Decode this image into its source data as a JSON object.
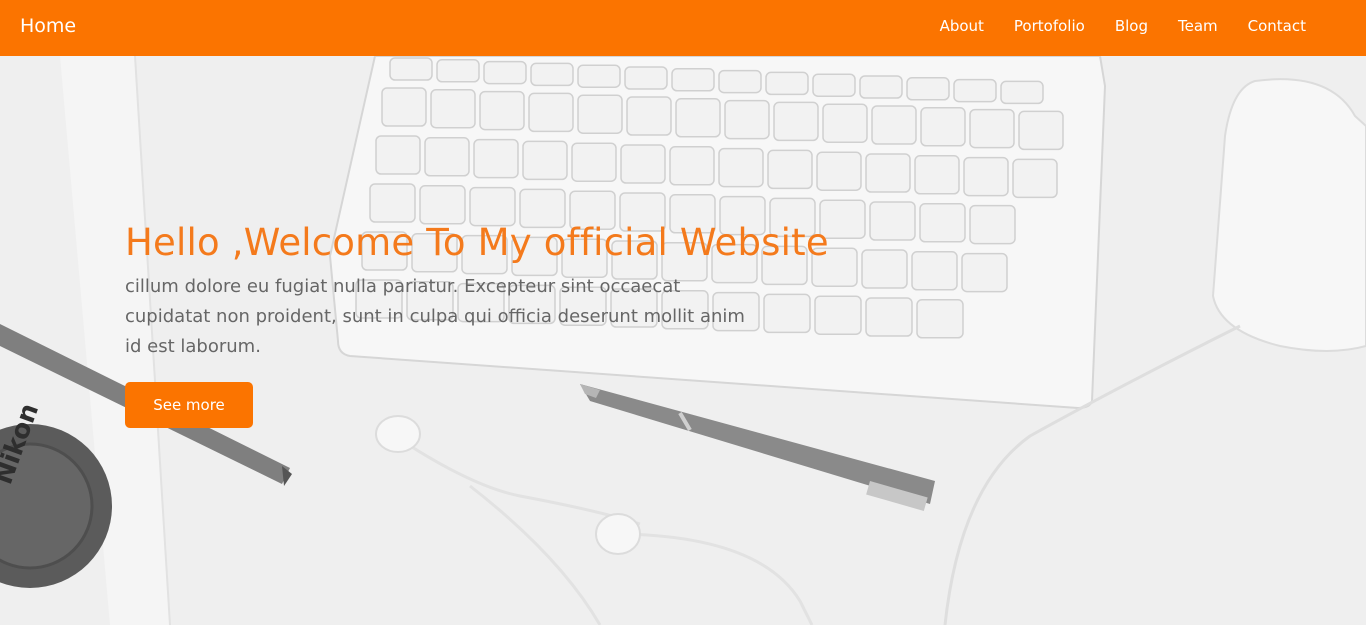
{
  "navbar": {
    "brand": "Home",
    "links": [
      "About",
      "Portofolio",
      "Blog",
      "Team",
      "Contact"
    ]
  },
  "hero": {
    "title": "Hello ,Welcome To My official Website",
    "text": "cillum dolore eu fugiat nulla pariatur. Excepteur sint occaecat cupidatat non proident, sunt in culpa qui officia deserunt mollit anim id est laborum.",
    "button_label": "See more",
    "background_image": "desk-with-keyboard-mouse-pen-earphones-camera-lens-cap",
    "lens_cap_text": "Nikon"
  },
  "colors": {
    "accent": "#fb7400",
    "title": "#f47a1c",
    "body_text": "#666666",
    "hero_bg": "#efefef"
  }
}
